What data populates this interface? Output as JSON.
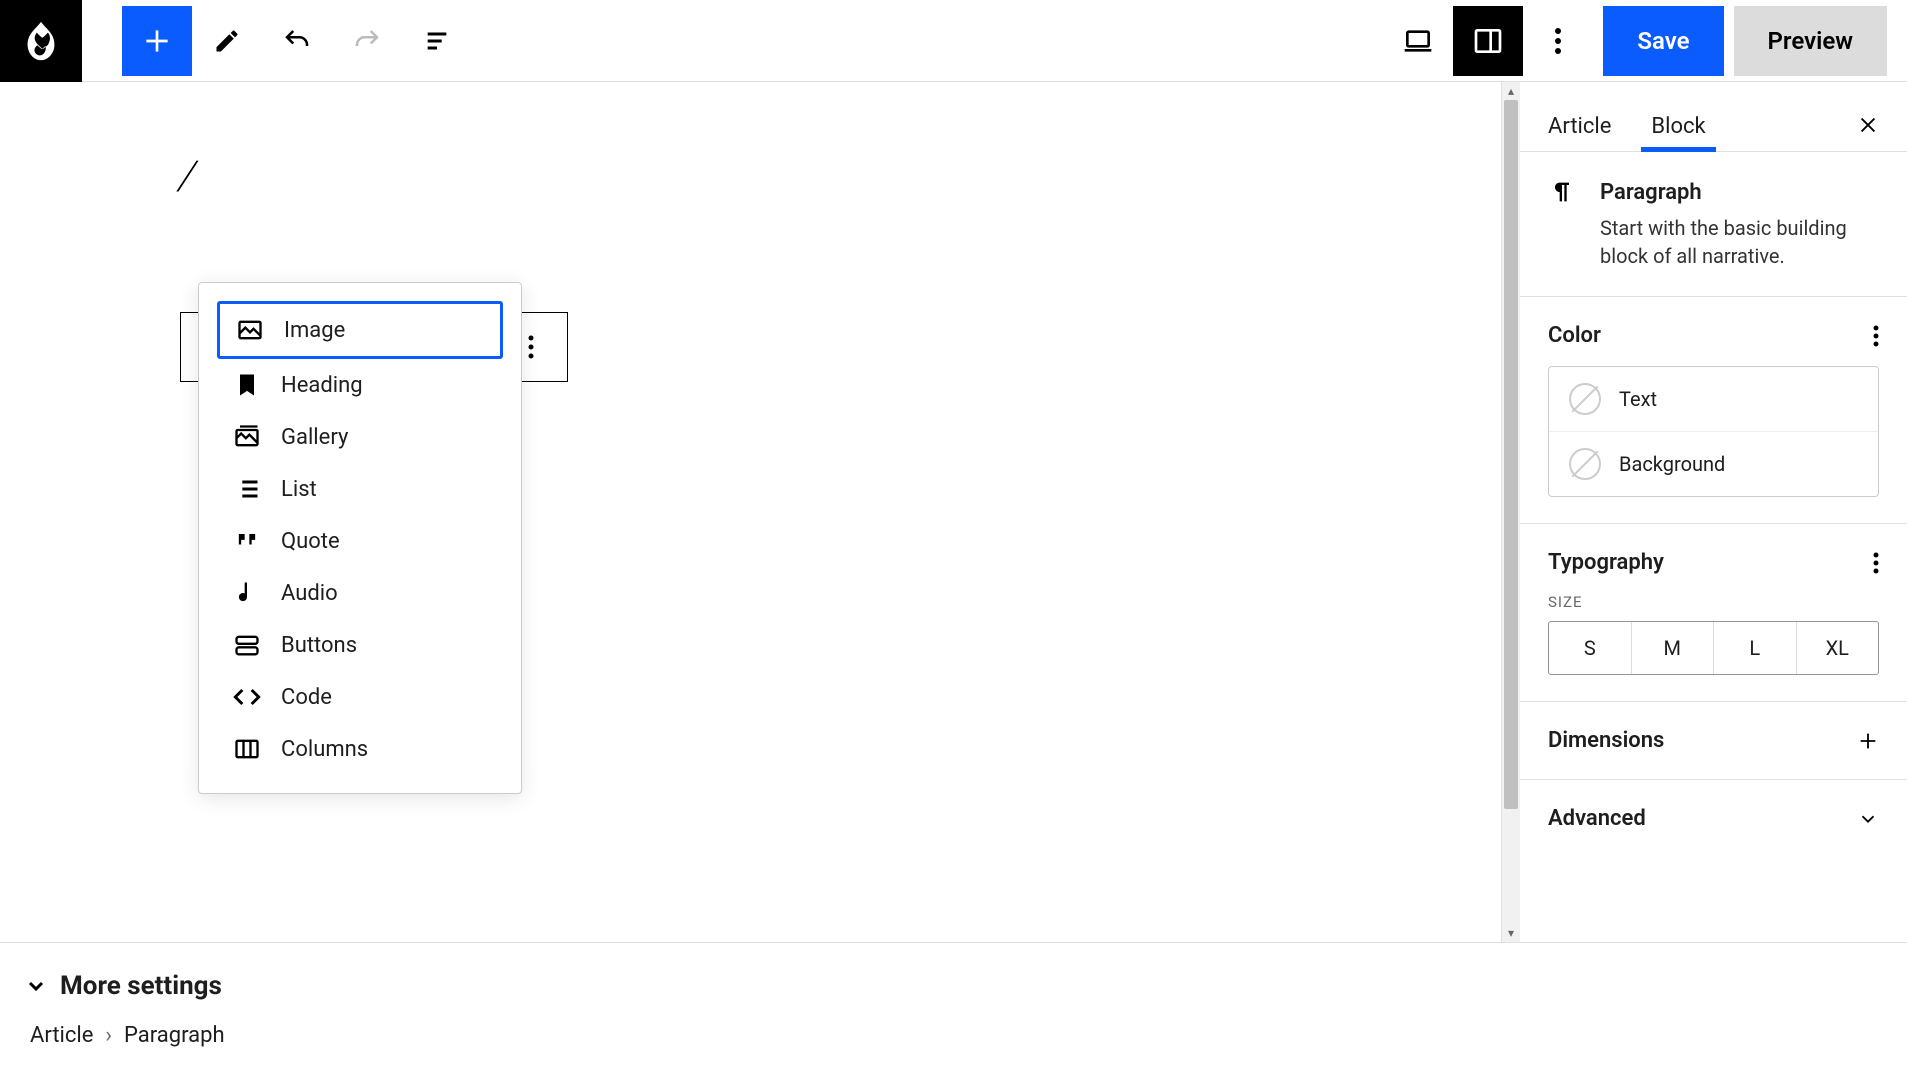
{
  "topbar": {
    "save": "Save",
    "preview": "Preview"
  },
  "canvas": {
    "slash": "/"
  },
  "popup": {
    "items": [
      {
        "label": "Image",
        "selected": true
      },
      {
        "label": "Heading"
      },
      {
        "label": "Gallery"
      },
      {
        "label": "List"
      },
      {
        "label": "Quote"
      },
      {
        "label": "Audio"
      },
      {
        "label": "Buttons"
      },
      {
        "label": "Code"
      },
      {
        "label": "Columns"
      }
    ]
  },
  "sidebar": {
    "tabs": {
      "article": "Article",
      "block": "Block"
    },
    "block_info": {
      "title": "Paragraph",
      "desc": "Start with the basic building block of all narrative."
    },
    "color": {
      "heading": "Color",
      "text": "Text",
      "background": "Background"
    },
    "typography": {
      "heading": "Typography",
      "size_label": "SIZE",
      "sizes": [
        "S",
        "M",
        "L",
        "XL"
      ]
    },
    "dimensions": {
      "heading": "Dimensions"
    },
    "advanced": {
      "heading": "Advanced"
    }
  },
  "bottom": {
    "more": "More settings",
    "crumbs": [
      "Article",
      "Paragraph"
    ]
  }
}
